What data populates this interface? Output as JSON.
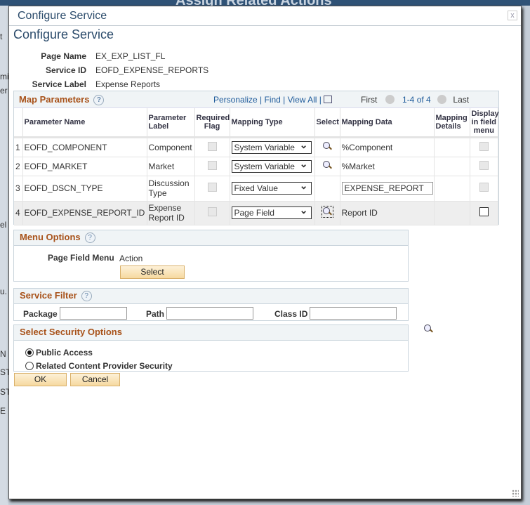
{
  "background": {
    "title": "Assign Related Actions",
    "fragments": [
      "t",
      "mi",
      "er",
      "el",
      "u.",
      "N",
      "ST",
      "ST",
      "E"
    ]
  },
  "modal": {
    "title": "Configure Service",
    "close": "x"
  },
  "page_title": "Configure Service",
  "fields": [
    {
      "label": "Page Name",
      "value": "EX_EXP_LIST_FL"
    },
    {
      "label": "Service ID",
      "value": "EOFD_EXPENSE_REPORTS"
    },
    {
      "label": "Service Label",
      "value": "Expense Reports"
    }
  ],
  "map_parameters": {
    "title": "Map Parameters",
    "help": "?",
    "personalize": "Personalize",
    "find": "Find",
    "view_all": "View All",
    "first": "First",
    "range": "1-4 of 4",
    "last": "Last",
    "columns": [
      "Parameter Name",
      "Parameter Label",
      "Required Flag",
      "Mapping Type",
      "Select",
      "Mapping Data",
      "Mapping Details",
      "Display in field menu"
    ],
    "rows": [
      {
        "num": "1",
        "name": "EOFD_COMPONENT",
        "label": "Component",
        "mapping_type": "System Variable",
        "has_select": true,
        "data": "%Component",
        "data_input": false,
        "display_enabled": false
      },
      {
        "num": "2",
        "name": "EOFD_MARKET",
        "label": "Market",
        "mapping_type": "System Variable",
        "has_select": true,
        "data": "%Market",
        "data_input": false,
        "display_enabled": false
      },
      {
        "num": "3",
        "name": "EOFD_DSCN_TYPE",
        "label": "Discussion Type",
        "mapping_type": "Fixed Value",
        "has_select": false,
        "data": "EXPENSE_REPORT",
        "data_input": true,
        "display_enabled": false
      },
      {
        "num": "4",
        "name": "EOFD_EXPENSE_REPORT_ID",
        "label": "Expense Report ID",
        "mapping_type": "Page Field",
        "has_select": true,
        "data": "Report ID",
        "data_input": false,
        "display_enabled": true
      }
    ]
  },
  "menu_options": {
    "title": "Menu Options",
    "help": "?",
    "label": "Page Field Menu",
    "value": "Action",
    "select_button": "Select"
  },
  "service_filter": {
    "title": "Service Filter",
    "help": "?",
    "package_label": "Package",
    "package_value": "",
    "path_label": "Path",
    "path_value": "",
    "class_label": "Class ID",
    "class_value": ""
  },
  "security": {
    "title": "Select Security Options",
    "options": [
      {
        "label": "Public Access",
        "selected": true
      },
      {
        "label": "Related Content Provider Security",
        "selected": false
      }
    ]
  },
  "buttons": {
    "ok": "OK",
    "cancel": "Cancel"
  },
  "colors": {
    "section_title": "#a8521a",
    "heading": "#2b4b6b",
    "link": "#1d5a9a",
    "button": "#f6d9a0"
  }
}
